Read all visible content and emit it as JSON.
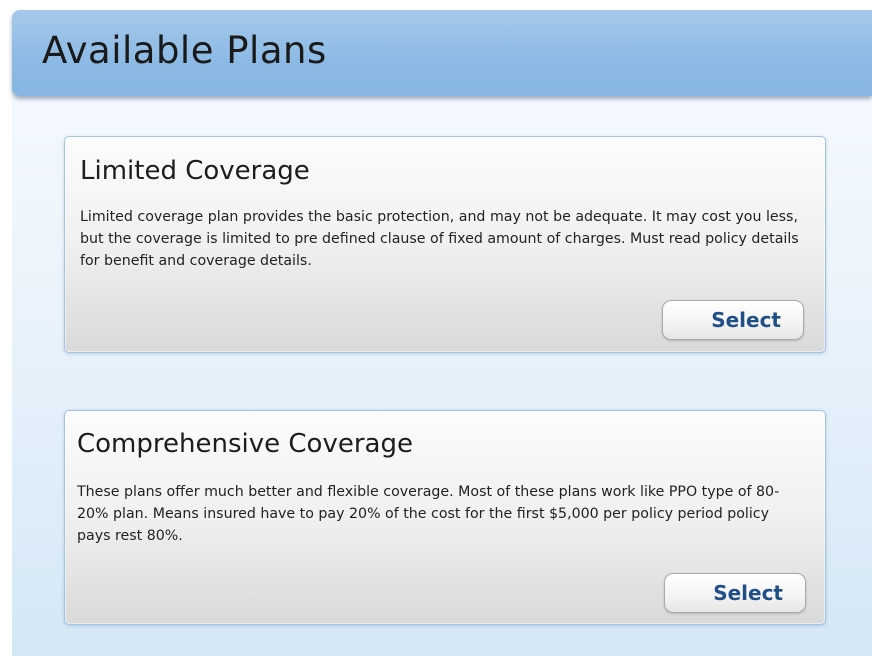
{
  "header": {
    "title": "Available Plans"
  },
  "plans": [
    {
      "title": "Limited Coverage",
      "description": "Limited coverage plan provides the basic protection, and may not be adequate. It may cost you less, but the coverage is limited to pre defined clause of fixed amount of charges. Must read policy details for benefit and coverage details.",
      "button_label": "Select"
    },
    {
      "title": "Comprehensive Coverage",
      "description": "These plans offer much better and flexible coverage. Most of these plans work like PPO type of 80-20% plan. Means insured have to pay 20% of the cost for the first $5,000 per policy period policy pays rest 80%.",
      "button_label": "Select"
    }
  ],
  "colors": {
    "header_bg": "#8ebbe5",
    "panel_bg": "#eaf3fb",
    "card_border": "#9fc4e4",
    "button_text": "#1f4f86"
  }
}
